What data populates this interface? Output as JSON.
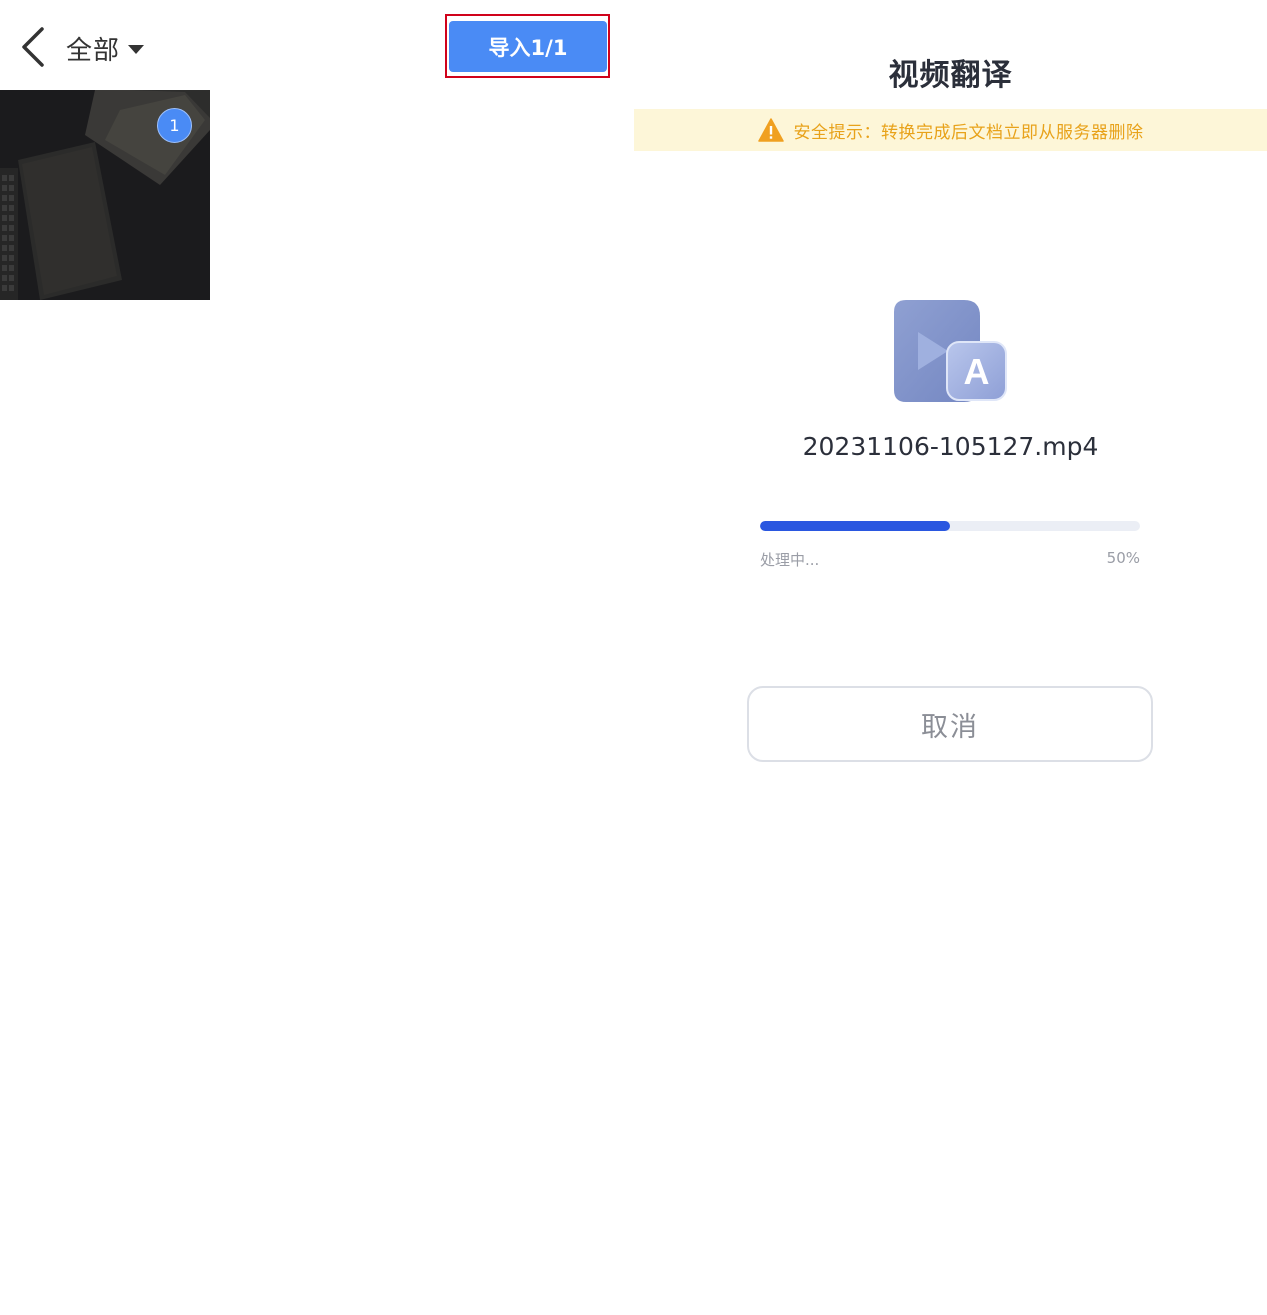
{
  "picker": {
    "album_label": "全部",
    "import_button_label": "导入1/1",
    "selected_badge": "1"
  },
  "translate": {
    "title": "视频翻译",
    "security_notice": "安全提示：转换完成后文档立即从服务器删除",
    "file_name": "20231106-105127.mp4",
    "progress_status": "处理中...",
    "progress_percent_label": "50%",
    "progress_value": 0.5,
    "cancel_label": "取消"
  },
  "colors": {
    "accent_blue": "#4a8bf5",
    "progress_blue": "#2a57e0",
    "warning_orange": "#e8a21a",
    "banner_bg": "#fdf6d8",
    "highlight_red": "#d0021b"
  },
  "icons": {
    "back": "chevron-left-icon",
    "album_dropdown": "caret-down-icon",
    "warning": "warning-icon",
    "file": "video-translate-icon"
  }
}
